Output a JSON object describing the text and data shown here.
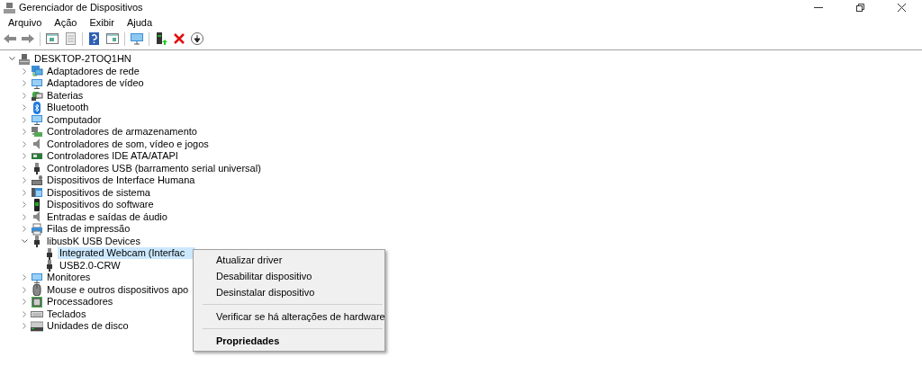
{
  "window": {
    "title": "Gerenciador de Dispositivos"
  },
  "menu": [
    "Arquivo",
    "Ação",
    "Exibir",
    "Ajuda"
  ],
  "toolbar": [
    {
      "kind": "back"
    },
    {
      "kind": "forward"
    },
    {
      "kind": "sep"
    },
    {
      "kind": "tree"
    },
    {
      "kind": "props"
    },
    {
      "kind": "sep"
    },
    {
      "kind": "help"
    },
    {
      "kind": "view"
    },
    {
      "kind": "sep"
    },
    {
      "kind": "scan"
    },
    {
      "kind": "sep"
    },
    {
      "kind": "update"
    },
    {
      "kind": "remove"
    },
    {
      "kind": "download"
    }
  ],
  "tree": {
    "label": "DESKTOP-2TOQ1HN",
    "kind": "pc",
    "expanded": true,
    "children": [
      {
        "label": "Adaptadores de rede",
        "kind": "net",
        "expanded": false,
        "selected": false
      },
      {
        "label": "Adaptadores de vídeo",
        "kind": "monitor",
        "expanded": false,
        "selected": false
      },
      {
        "label": "Baterias",
        "kind": "battery",
        "expanded": false,
        "selected": false
      },
      {
        "label": "Bluetooth",
        "kind": "bluetooth",
        "expanded": false,
        "selected": false
      },
      {
        "label": "Computador",
        "kind": "monitor",
        "expanded": false,
        "selected": false
      },
      {
        "label": "Controladores de armazenamento",
        "kind": "storage",
        "expanded": false,
        "selected": false
      },
      {
        "label": "Controladores de som, vídeo e jogos",
        "kind": "speaker",
        "expanded": false,
        "selected": false
      },
      {
        "label": "Controladores IDE ATA/ATAPI",
        "kind": "card",
        "expanded": false,
        "selected": false
      },
      {
        "label": "Controladores USB (barramento serial universal)",
        "kind": "usb",
        "expanded": false,
        "selected": false
      },
      {
        "label": "Dispositivos de Interface Humana",
        "kind": "hid",
        "expanded": false,
        "selected": false
      },
      {
        "label": "Dispositivos de sistema",
        "kind": "folder",
        "expanded": false,
        "selected": false
      },
      {
        "label": "Dispositivos do software",
        "kind": "phone",
        "expanded": false,
        "selected": false
      },
      {
        "label": "Entradas e saídas de áudio",
        "kind": "speaker",
        "expanded": false,
        "selected": false
      },
      {
        "label": "Filas de impressão",
        "kind": "printer",
        "expanded": false,
        "selected": false
      },
      {
        "label": "libusbK USB Devices",
        "kind": "usb",
        "expanded": true,
        "selected": false,
        "children": [
          {
            "label": "Integrated Webcam (Interfac",
            "kind": "usb",
            "selected": true
          },
          {
            "label": "USB2.0-CRW",
            "kind": "usb",
            "selected": false
          }
        ]
      },
      {
        "label": "Monitores",
        "kind": "monitor",
        "expanded": false,
        "selected": false
      },
      {
        "label": "Mouse e outros dispositivos apo",
        "kind": "mouse",
        "expanded": false,
        "selected": false
      },
      {
        "label": "Processadores",
        "kind": "chip",
        "expanded": false,
        "selected": false
      },
      {
        "label": "Teclados",
        "kind": "keyboard",
        "expanded": false,
        "selected": false
      },
      {
        "label": "Unidades de disco",
        "kind": "disk",
        "expanded": false,
        "selected": false
      }
    ]
  },
  "context_menu": [
    {
      "label": "Atualizar driver",
      "kind": "item"
    },
    {
      "label": "Desabilitar dispositivo",
      "kind": "item"
    },
    {
      "label": "Desinstalar dispositivo",
      "kind": "item"
    },
    {
      "kind": "sep"
    },
    {
      "label": "Verificar se há alterações de hardware",
      "kind": "item"
    },
    {
      "kind": "sep"
    },
    {
      "label": "Propriedades",
      "kind": "default"
    }
  ]
}
